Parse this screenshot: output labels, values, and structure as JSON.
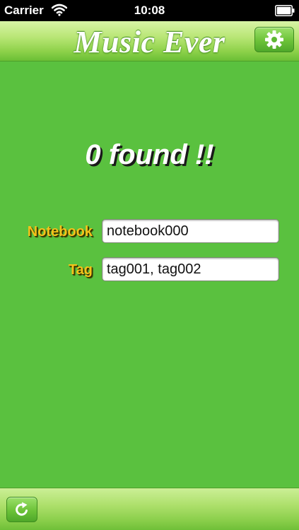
{
  "status_bar": {
    "carrier": "Carrier",
    "time": "10:08",
    "wifi_icon": "wifi-icon",
    "battery_icon": "battery-icon"
  },
  "nav_bar": {
    "title": "Music Ever",
    "settings_icon": "gear-icon"
  },
  "main": {
    "result_text": "0 found !!",
    "notebook": {
      "label": "Notebook",
      "value": "notebook000"
    },
    "tag": {
      "label": "Tag",
      "value": "tag001, tag002"
    }
  },
  "toolbar": {
    "refresh_icon": "refresh-icon"
  },
  "colors": {
    "background": "#5ac13f",
    "label_gold": "#f5c21a",
    "bar_green": "#8fd24b"
  }
}
